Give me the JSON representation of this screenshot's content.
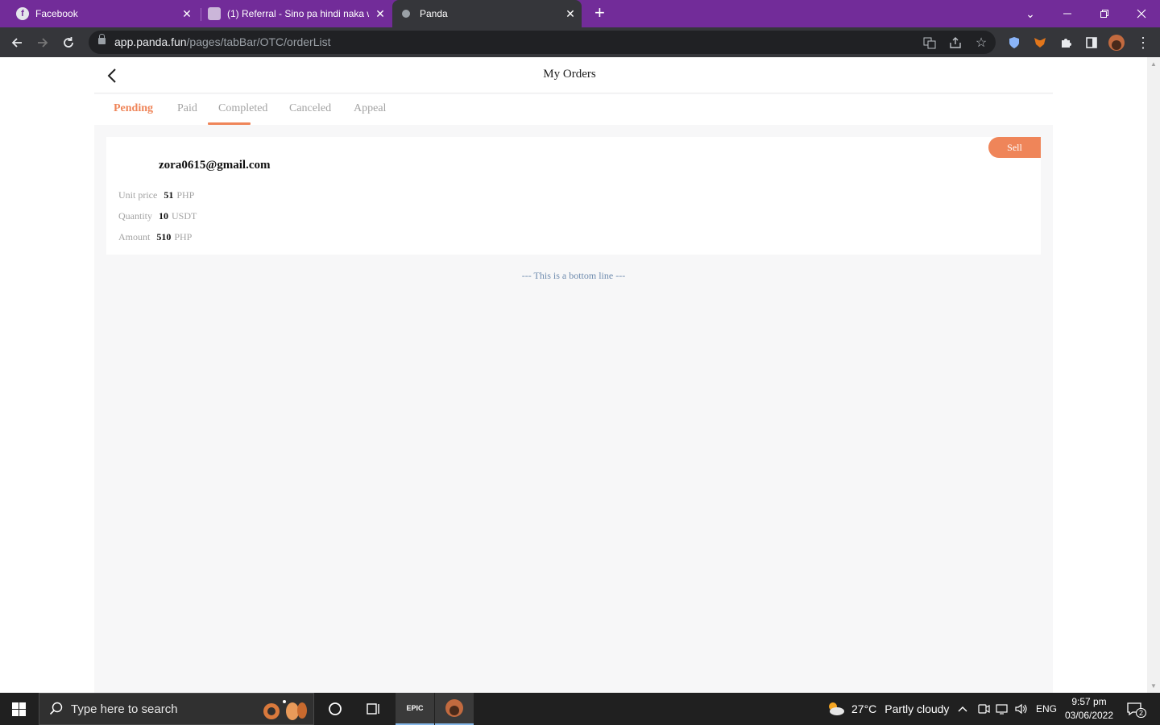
{
  "browser": {
    "tabs": [
      {
        "title": "Facebook",
        "icon": "facebook-icon"
      },
      {
        "title": "(1) Referral - Sino pa hindi naka w",
        "icon": "referral-favicon"
      },
      {
        "title": "Panda",
        "icon": "panda-favicon"
      }
    ],
    "close_glyph": "✕",
    "new_tab_glyph": "+",
    "url_host": "app.panda.fun",
    "url_path": "/pages/tabBar/OTC/orderList"
  },
  "page": {
    "title": "My Orders",
    "tabs": [
      "Pending",
      "Paid",
      "Completed",
      "Canceled",
      "Appeal"
    ],
    "active_tab": "Pending",
    "order": {
      "side": "Sell",
      "counterparty": "zora0615@gmail.com",
      "unit_price_label": "Unit price",
      "unit_price_value": "51",
      "unit_price_unit": "PHP",
      "quantity_label": "Quantity",
      "quantity_value": "10",
      "quantity_unit": "USDT",
      "amount_label": "Amount",
      "amount_value": "510",
      "amount_unit": "PHP"
    },
    "bottom_line": "--- This is a bottom line ---",
    "accent_color": "#ef8559"
  },
  "taskbar": {
    "search_placeholder": "Type here to search",
    "epic_label": "EPIC",
    "weather_temp": "27°C",
    "weather_text": "Partly cloudy",
    "language": "ENG",
    "time": "9:57 pm",
    "date": "03/06/2022",
    "notification_count": "2"
  }
}
